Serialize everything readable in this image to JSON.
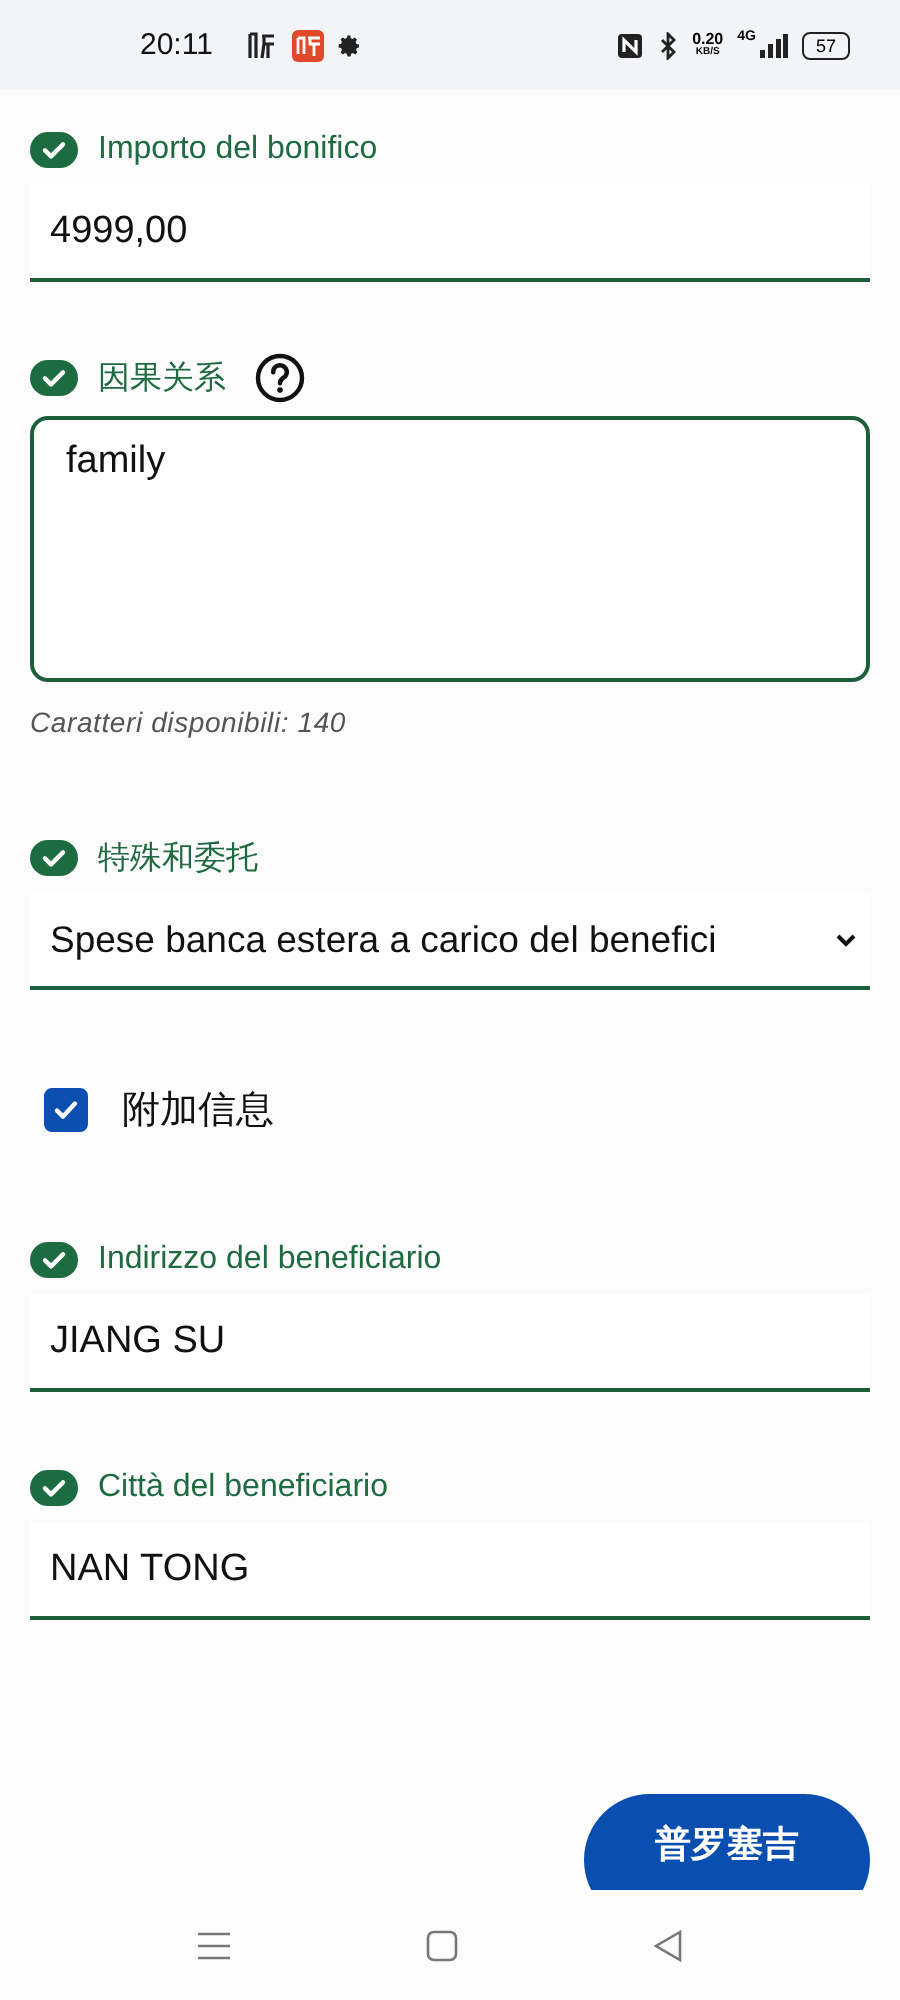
{
  "status_bar": {
    "time": "20:11",
    "speed": "0.20",
    "speed_unit": "KB/S",
    "network": "4G",
    "battery": "57"
  },
  "fields": [
    {
      "kind": "text",
      "label": "Importo del bonifico",
      "valid": true,
      "value": "4999,00"
    },
    {
      "kind": "textarea",
      "label": "因果关系",
      "valid": true,
      "help": true,
      "value": "family",
      "helper": "Caratteri disponibili: 140"
    },
    {
      "kind": "select",
      "label": "特殊和委托",
      "valid": true,
      "value": "Spese banca estera a carico del benefici"
    },
    {
      "kind": "checkbox",
      "label": "附加信息",
      "checked": true
    },
    {
      "kind": "text",
      "label": "Indirizzo del beneficiario",
      "valid": true,
      "value": "JIANG SU"
    },
    {
      "kind": "text",
      "label": "Città del beneficiario",
      "valid": true,
      "value": "NAN TONG"
    }
  ],
  "button": {
    "label": "普罗塞吉"
  }
}
